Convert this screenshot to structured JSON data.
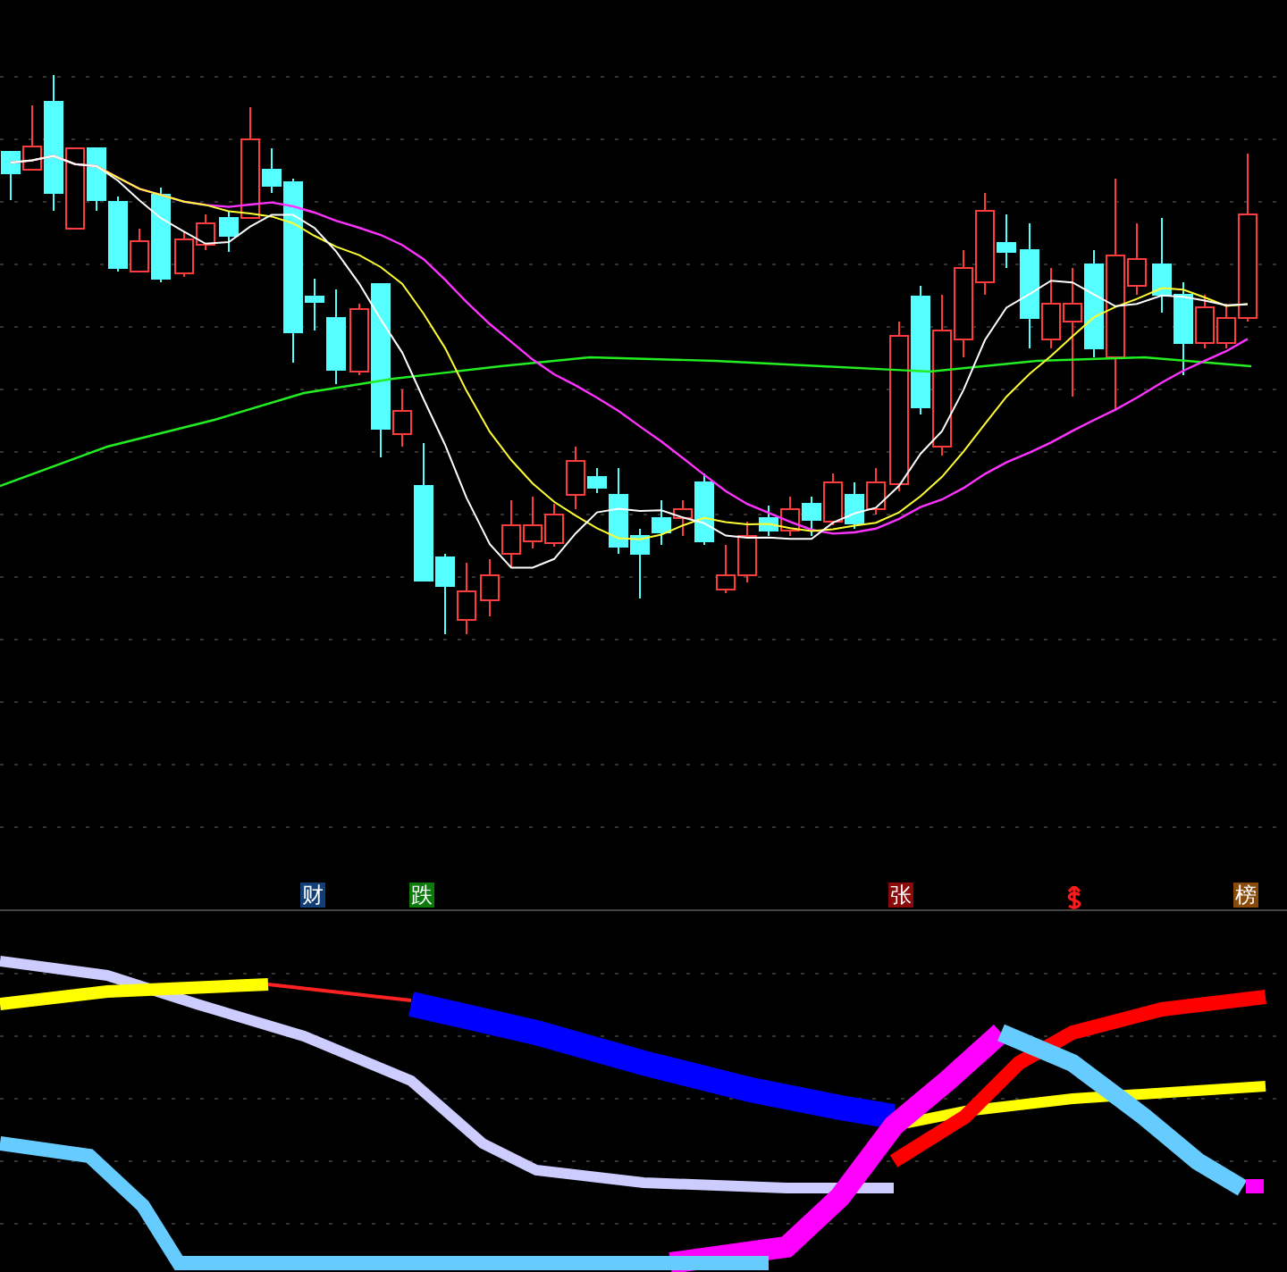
{
  "signal_markers": [
    {
      "kind": "text",
      "label": "财",
      "color": "#123f78"
    },
    {
      "kind": "text",
      "label": "跌",
      "color": "#0b7a0b"
    },
    {
      "kind": "text",
      "label": "张",
      "color": "#8a0a0a"
    },
    {
      "kind": "dollar",
      "color": "#ff1a1a"
    },
    {
      "kind": "text",
      "label": "榜",
      "color": "#8a4a0a"
    }
  ]
}
